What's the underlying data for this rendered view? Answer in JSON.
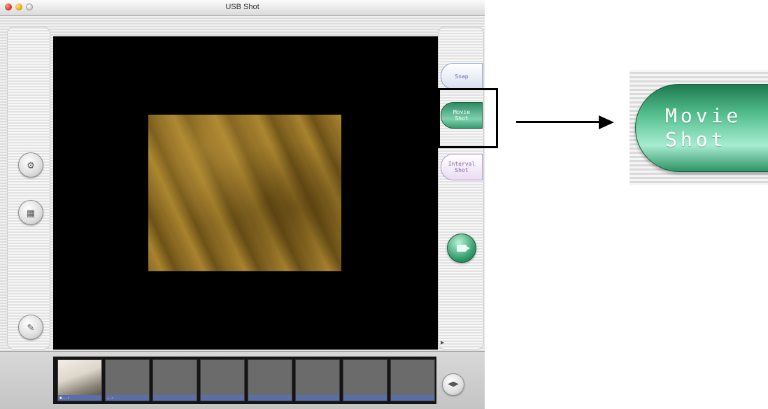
{
  "window": {
    "title": "USB Shot"
  },
  "right_panel": {
    "snap_label": "Snap",
    "movie_line1": "Movie",
    "movie_line2": "Shot",
    "interval_line1": "Interval",
    "interval_line2": "Shot"
  },
  "left_panel": {
    "button1_icon": "camera-settings-icon",
    "button2_icon": "video-source-icon",
    "button3_icon": "edit-icon",
    "button4_icon": "import-icon"
  },
  "filmstrip": {
    "thumbs": [
      {
        "label": "■ ... ▫"
      },
      {
        "label": "... ▫"
      },
      {
        "label": ""
      },
      {
        "label": ""
      },
      {
        "label": ""
      },
      {
        "label": ""
      },
      {
        "label": ""
      },
      {
        "label": ""
      }
    ]
  },
  "callout": {
    "zoom_line1": "Movie",
    "zoom_line2": "Shot"
  },
  "colors": {
    "movie_button": "#3fae7c",
    "snap_button": "#d9dff0",
    "interval_button": "#e9ddf2",
    "thumb_bar": "#5a6ea8"
  }
}
